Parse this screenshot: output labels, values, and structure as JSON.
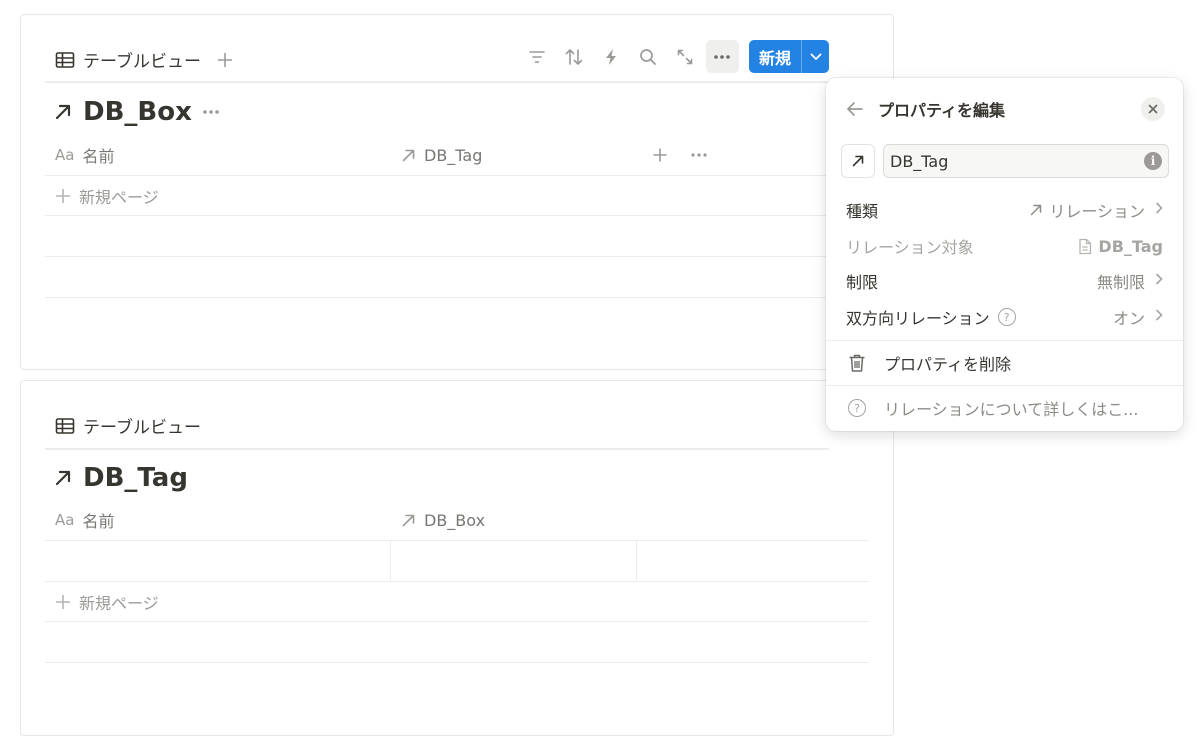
{
  "boards": [
    {
      "view_tab_label": "テーブルビュー",
      "db_title": "DB_Box",
      "columns": [
        {
          "prefix": "Aa",
          "label": "名前"
        },
        {
          "label": "DB_Tag"
        }
      ],
      "new_page_label": "新規ページ",
      "toolbar": {
        "new_label": "新規",
        "icons": [
          "filter-icon",
          "sort-icon",
          "automation-icon",
          "search-icon",
          "expand-icon",
          "more-icon"
        ]
      }
    },
    {
      "view_tab_label": "テーブルビュー",
      "db_title": "DB_Tag",
      "columns": [
        {
          "prefix": "Aa",
          "label": "名前"
        },
        {
          "label": "DB_Box"
        }
      ],
      "new_page_label": "新規ページ"
    }
  ],
  "popup": {
    "title": "プロパティを編集",
    "name_value": "DB_Tag",
    "rows": [
      {
        "key": "種類",
        "value": "リレーション"
      },
      {
        "key": "リレーション対象",
        "value": "DB_Tag"
      },
      {
        "key": "制限",
        "value": "無制限"
      },
      {
        "key": "双方向リレーション",
        "value": "オン"
      }
    ],
    "delete_label": "プロパティを削除",
    "help_label": "リレーションについて詳しくはこ..."
  }
}
